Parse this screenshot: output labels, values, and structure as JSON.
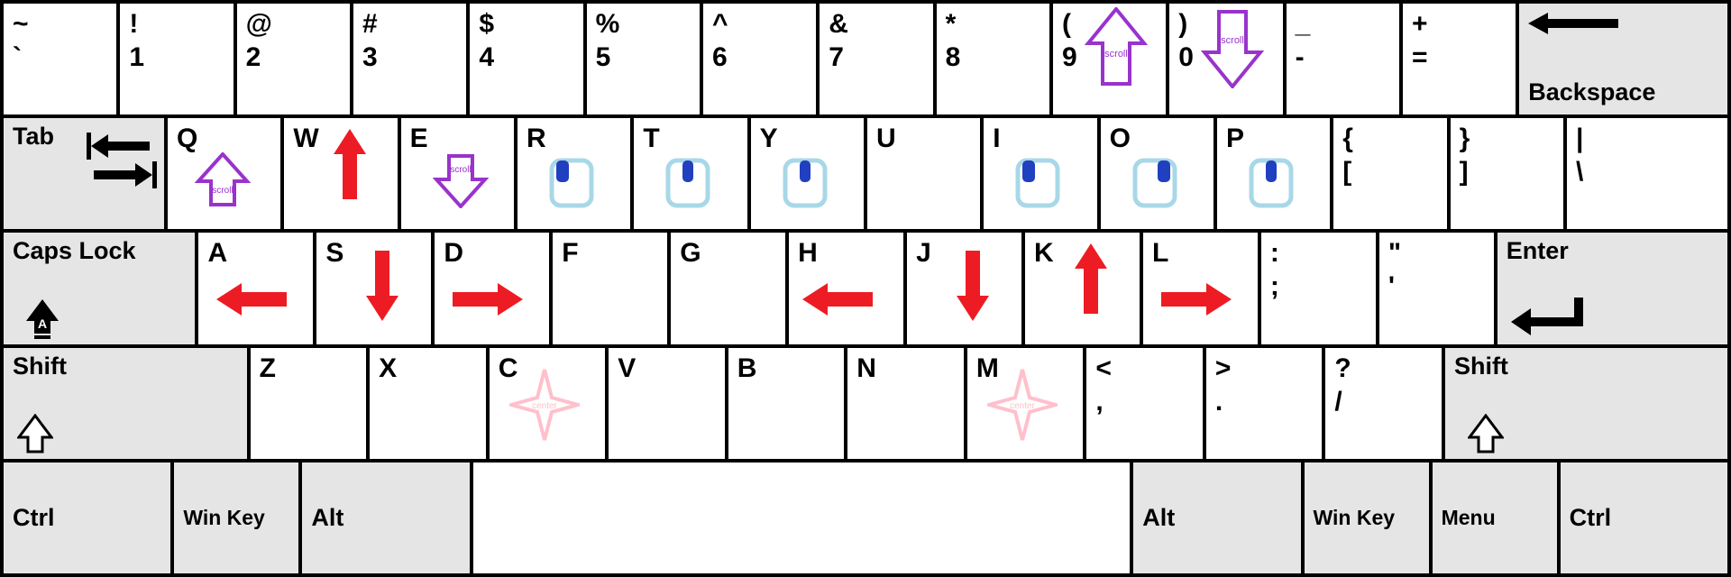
{
  "row1": {
    "tilde": {
      "upper": "~",
      "lower": "`"
    },
    "n1": {
      "upper": "!",
      "lower": "1"
    },
    "n2": {
      "upper": "@",
      "lower": "2"
    },
    "n3": {
      "upper": "#",
      "lower": "3"
    },
    "n4": {
      "upper": "$",
      "lower": "4"
    },
    "n5": {
      "upper": "%",
      "lower": "5"
    },
    "n6": {
      "upper": "^",
      "lower": "6"
    },
    "n7": {
      "upper": "&",
      "lower": "7"
    },
    "n8": {
      "upper": "*",
      "lower": "8"
    },
    "n9": {
      "upper": "(",
      "lower": "9",
      "scroll": "scroll"
    },
    "n0": {
      "upper": ")",
      "lower": "0",
      "scroll": "scroll"
    },
    "dash": {
      "upper": "_",
      "lower": "-"
    },
    "eq": {
      "upper": "+",
      "lower": "="
    },
    "backspace": "Backspace"
  },
  "row2": {
    "tab": "Tab",
    "q": {
      "letter": "Q",
      "scroll": "scroll"
    },
    "w": {
      "letter": "W"
    },
    "e": {
      "letter": "E",
      "scroll": "scroll"
    },
    "r": {
      "letter": "R"
    },
    "t": {
      "letter": "T"
    },
    "y": {
      "letter": "Y"
    },
    "u": {
      "letter": "U"
    },
    "i": {
      "letter": "I"
    },
    "o": {
      "letter": "O"
    },
    "p": {
      "letter": "P"
    },
    "lb": {
      "upper": "{",
      "lower": "["
    },
    "rb": {
      "upper": "}",
      "lower": "]"
    },
    "bs": {
      "upper": "|",
      "lower": "\\"
    }
  },
  "row3": {
    "caps": "Caps Lock",
    "a": {
      "letter": "A"
    },
    "s": {
      "letter": "S"
    },
    "d": {
      "letter": "D"
    },
    "f": {
      "letter": "F"
    },
    "g": {
      "letter": "G"
    },
    "h": {
      "letter": "H"
    },
    "j": {
      "letter": "J"
    },
    "k": {
      "letter": "K"
    },
    "l": {
      "letter": "L"
    },
    "semi": {
      "upper": ":",
      "lower": ";"
    },
    "quote": {
      "upper": "\"",
      "lower": "'"
    },
    "enter": "Enter"
  },
  "row4": {
    "lshift": "Shift",
    "z": {
      "letter": "Z"
    },
    "x": {
      "letter": "X"
    },
    "c": {
      "letter": "C",
      "center": "center"
    },
    "v": {
      "letter": "V"
    },
    "b": {
      "letter": "B"
    },
    "n": {
      "letter": "N"
    },
    "m": {
      "letter": "M",
      "center": "center"
    },
    "comma": {
      "upper": "<",
      "lower": ","
    },
    "period": {
      "upper": ">",
      "lower": "."
    },
    "slash": {
      "upper": "?",
      "lower": "/"
    },
    "rshift": "Shift"
  },
  "row5": {
    "lctrl": "Ctrl",
    "lwin": "Win Key",
    "lalt": "Alt",
    "ralt": "Alt",
    "rwin": "Win Key",
    "menu": "Menu",
    "rctrl": "Ctrl"
  },
  "colors": {
    "red": "#ed1c24",
    "purple": "#9933cc",
    "pink": "#ffc0cb",
    "lightblue": "#a8d8e8",
    "darkblue": "#2040c0"
  }
}
